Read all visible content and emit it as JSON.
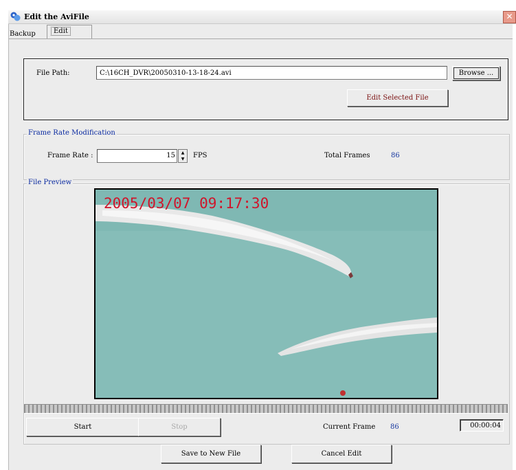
{
  "window": {
    "title": "Edit the AviFile",
    "close_glyph": "✕"
  },
  "tabs": [
    {
      "label": "Backup",
      "active": false
    },
    {
      "label": "Edit",
      "active": true
    }
  ],
  "file_path": {
    "label": "File Path:",
    "value": "C:\\16CH_DVR\\20050310-13-18-24.avi",
    "browse_label": "Browse ...",
    "edit_selected_label": "Edit Selected File"
  },
  "frame_rate": {
    "group_title": "Frame Rate Modification",
    "label": "Frame Rate :",
    "value": "15",
    "unit": "FPS",
    "total_frames_label": "Total Frames",
    "total_frames_value": "86"
  },
  "preview": {
    "group_title": "File Preview",
    "timestamp_overlay": "2005/03/07 09:17:30",
    "start_label": "Start",
    "stop_label": "Stop",
    "current_frame_label": "Current Frame",
    "current_frame_value": "86",
    "elapsed_time": "00:00:04"
  },
  "footer": {
    "save_label": "Save to New File",
    "cancel_label": "Cancel Edit"
  },
  "colors": {
    "video_sea": "#7fb8b3",
    "smoke": "#e9e9e9",
    "group_title": "#0a2aa0",
    "timestamp": "#d0142a"
  },
  "icons": {
    "app": "app-icon",
    "close": "close-icon",
    "spinner_up": "spinner-up-icon",
    "spinner_down": "spinner-down-icon"
  }
}
